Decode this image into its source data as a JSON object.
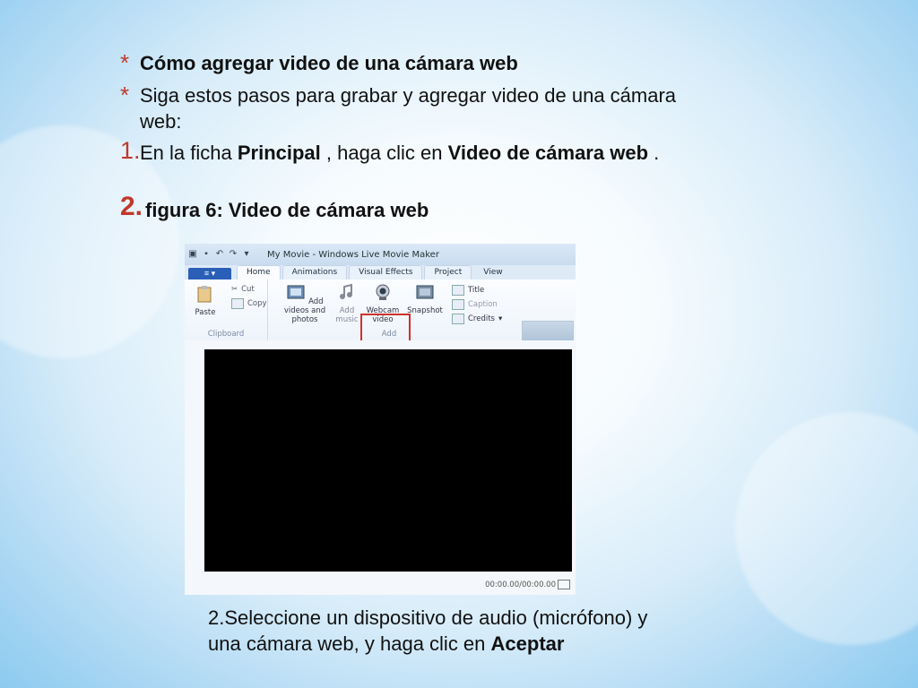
{
  "bullets": [
    {
      "marker": "*",
      "text": "Cómo agregar video de una cámara web"
    },
    {
      "marker": "*",
      "text": "Siga estos pasos para grabar y agregar video de una cámara web:"
    }
  ],
  "step1": {
    "marker": "1.",
    "pre": "En la ficha ",
    "b1": "Principal",
    "mid": " , haga clic en ",
    "b2": "Video de cámara web",
    "post": " ."
  },
  "step2": {
    "marker": "2.",
    "text": "figura 6: Video de cámara web"
  },
  "window": {
    "title": "My Movie - Windows Live Movie Maker",
    "tabs": [
      "Home",
      "Animations",
      "Visual Effects",
      "Project",
      "View"
    ],
    "ribbon": {
      "paste": "Paste",
      "cut": "Cut",
      "copy": "Copy",
      "clipboard_group": "Clipboard",
      "add_videos": "Add videos and photos",
      "add_music": "Add music",
      "webcam": "Webcam video",
      "snapshot": "Snapshot",
      "title": "Title",
      "caption": "Caption",
      "credits": "Credits",
      "add_group": "Add"
    },
    "time": "00:00.00/00:00.00"
  },
  "caption_step": {
    "pre": "2.Seleccione un dispositivo de audio (micrófono) y una cámara web, y haga clic en ",
    "bold": "Aceptar"
  },
  "colors": {
    "accent": "#c0392b",
    "highlight": "#d0312d"
  }
}
